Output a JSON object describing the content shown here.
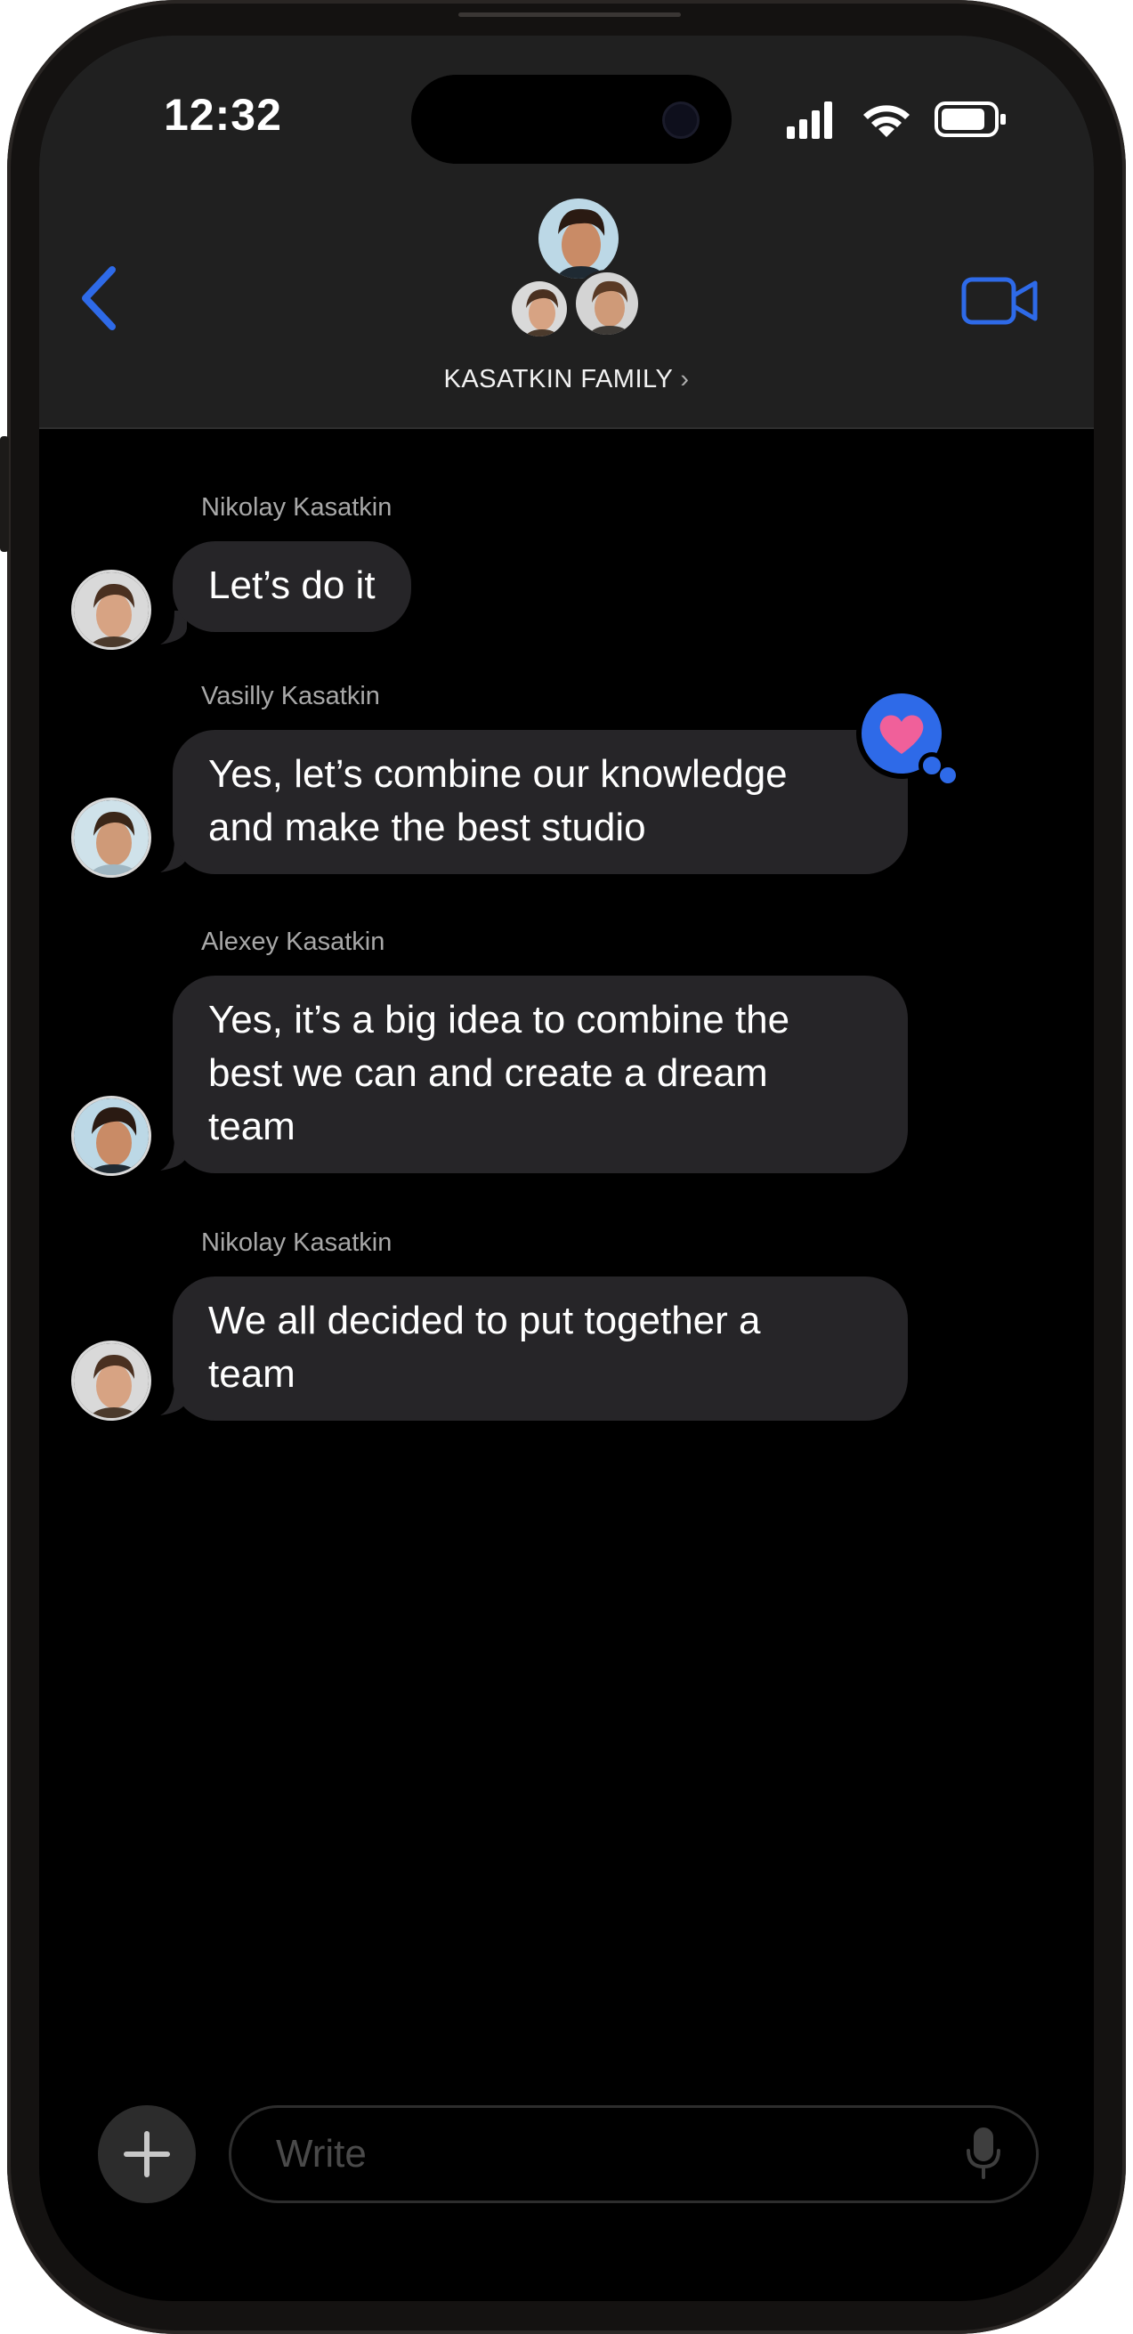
{
  "status_bar": {
    "time": "12:32"
  },
  "header": {
    "group_name": "KASATKIN FAMILY",
    "chevron": "›",
    "back_icon": "chevron-left-icon",
    "video_icon": "video-camera-icon"
  },
  "messages": [
    {
      "sender": "Nikolay Kasatkin",
      "text_lines": [
        "Let’s do it"
      ]
    },
    {
      "sender": "Vasilly Kasatkin",
      "text_lines": [
        "Yes, let’s combine our knowledge",
        "and make the best studio"
      ],
      "reaction": "heart-icon"
    },
    {
      "sender": "Alexey Kasatkin",
      "text_lines": [
        "Yes, it’s a big idea to combine the",
        "best we can and create a dream",
        "team"
      ]
    },
    {
      "sender": "Nikolay Kasatkin",
      "text_lines": [
        "We all decided to put together a",
        "team"
      ]
    }
  ],
  "composer": {
    "placeholder": "Write",
    "add_icon": "plus-icon",
    "mic_icon": "microphone-icon"
  },
  "colors": {
    "accent": "#2e6ae8",
    "bubble": "#262528",
    "header_bg": "#202020",
    "reaction_heart": "#f0609a"
  }
}
